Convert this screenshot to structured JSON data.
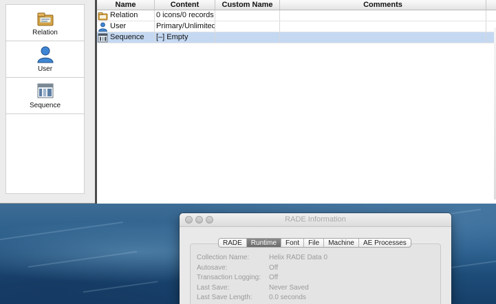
{
  "sidebar": {
    "items": [
      {
        "label": "Relation",
        "icon": "relation-icon"
      },
      {
        "label": "User",
        "icon": "user-icon"
      },
      {
        "label": "Sequence",
        "icon": "sequence-icon"
      }
    ]
  },
  "table": {
    "columns": [
      "Name",
      "Content",
      "Custom Name",
      "Comments"
    ],
    "rows": [
      {
        "name": "Relation",
        "content": "0 icons/0 records",
        "custom_name": "",
        "comments": "",
        "icon": "relation-icon"
      },
      {
        "name": "User",
        "content": "Primary/Unlimited",
        "custom_name": "",
        "comments": "",
        "icon": "user-icon"
      },
      {
        "name": "Sequence",
        "content": "[–] Empty",
        "custom_name": "",
        "comments": "",
        "icon": "sequence-icon",
        "selected": true
      }
    ]
  },
  "info_window": {
    "title": "RADE Information",
    "tabs": [
      "RADE",
      "Runtime",
      "Font",
      "File",
      "Machine",
      "AE Processes"
    ],
    "active_tab": "Runtime",
    "fields": [
      {
        "label": "Collection Name:",
        "value": "Helix RADE Data 0"
      },
      {
        "label": "Autosave:",
        "value": "Off"
      },
      {
        "label": "Transaction Logging:",
        "value": "Off"
      },
      {
        "label": "Last Save:",
        "value": "Never Saved"
      },
      {
        "label": "Last Save Length:",
        "value": "0.0 seconds"
      }
    ]
  },
  "colors": {
    "selection": "#c4d8f2",
    "active_tab": "#7a7a7a",
    "divider": "#4a4a4a"
  }
}
